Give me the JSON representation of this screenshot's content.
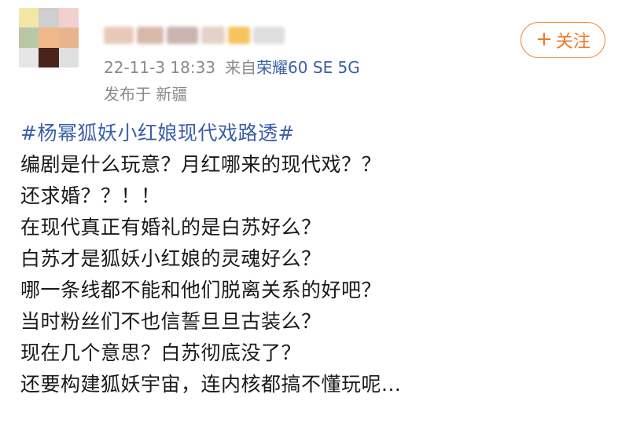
{
  "post": {
    "author": {
      "name_redacted": true,
      "avatar_colors": [
        "#f3e7a8",
        "#cfcfcf",
        "#f2d0d0",
        "#b9c7a6",
        "#f0b889",
        "#e8b48e",
        "#e6e6e6",
        "#4a241a",
        "#e0e0e0"
      ],
      "name_blur_colors": [
        "#e8c9b8",
        "#d7b9a8",
        "#c9b4ae",
        "#e4d1c7",
        "#f5c45e",
        "#dedede"
      ]
    },
    "meta": {
      "time": "22-11-3 18:33",
      "source_prefix": "来自",
      "device": "荣耀60 SE 5G"
    },
    "location": "发布于  新疆",
    "follow_button": {
      "plus": "+",
      "label": "关注",
      "accent": "#f07a28"
    },
    "hashtag": "#杨幂狐妖小红娘现代戏路透#",
    "lines": [
      "编剧是什么玩意？月红哪来的现代戏？？",
      "还求婚？？！！",
      "在现代真正有婚礼的是白苏好么？",
      "白苏才是狐妖小红娘的灵魂好么？",
      "哪一条线都不能和他们脱离关系的好吧？",
      "当时粉丝们不也信誓旦旦古装么？",
      "现在几个意思？白苏彻底没了？",
      "还要构建狐妖宇宙，连内核都搞不懂玩呢..."
    ],
    "link_color": "#3b5ea8"
  }
}
